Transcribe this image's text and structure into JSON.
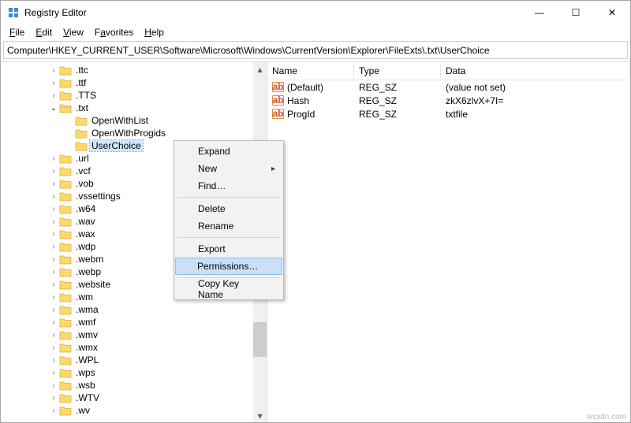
{
  "window": {
    "title": "Registry Editor",
    "buttons": {
      "min": "—",
      "max": "☐",
      "close": "✕"
    }
  },
  "menubar": {
    "file": "File",
    "edit": "Edit",
    "view": "View",
    "favorites": "Favorites",
    "help": "Help"
  },
  "path": "Computer\\HKEY_CURRENT_USER\\Software\\Microsoft\\Windows\\CurrentVersion\\Explorer\\FileExts\\.txt\\UserChoice",
  "tree": {
    "pre_items": [
      {
        "depth": 4,
        "chev": ">",
        "label": ".ttc"
      },
      {
        "depth": 4,
        "chev": ">",
        "label": ".ttf"
      },
      {
        "depth": 4,
        "chev": ">",
        "label": ".TTS"
      }
    ],
    "txt": {
      "depth": 4,
      "icon": "open",
      "label": ".txt"
    },
    "txt_children": [
      {
        "depth": 5,
        "label": "OpenWithList"
      },
      {
        "depth": 5,
        "label": "OpenWithProgids"
      },
      {
        "depth": 5,
        "label": "UserChoice",
        "selected": true
      }
    ],
    "post_items": [
      ".url",
      ".vcf",
      ".vob",
      ".vssettings",
      ".w64",
      ".wav",
      ".wax",
      ".wdp",
      ".webm",
      ".webp",
      ".website",
      ".wm",
      ".wma",
      ".wmf",
      ".wmv",
      ".wmx",
      ".WPL",
      ".wps",
      ".wsb",
      ".WTV",
      ".wv"
    ]
  },
  "list": {
    "columns": {
      "name": "Name",
      "type": "Type",
      "data": "Data"
    },
    "rows": [
      {
        "name": "(Default)",
        "type": "REG_SZ",
        "data": "(value not set)"
      },
      {
        "name": "Hash",
        "type": "REG_SZ",
        "data": "zkX6zlvX+7I="
      },
      {
        "name": "ProgId",
        "type": "REG_SZ",
        "data": "txtfile"
      }
    ]
  },
  "context_menu": {
    "items": [
      {
        "key": "expand",
        "label": "Expand"
      },
      {
        "key": "new",
        "label": "New",
        "submenu": true
      },
      {
        "key": "find",
        "label": "Find…"
      },
      {
        "sep": true
      },
      {
        "key": "delete",
        "label": "Delete"
      },
      {
        "key": "rename",
        "label": "Rename"
      },
      {
        "sep": true
      },
      {
        "key": "export",
        "label": "Export"
      },
      {
        "key": "permissions",
        "label": "Permissions…",
        "hover": true
      },
      {
        "sep": true
      },
      {
        "key": "copy-key-name",
        "label": "Copy Key Name"
      }
    ]
  },
  "watermark": "wsxdn.com",
  "icons": {
    "app_color": "#3a8ad6",
    "folder_fill": "#ffd96b",
    "folder_stroke": "#d7a93c",
    "reg_ab_bg": "#fff",
    "reg_ab_border": "#d28f3b",
    "reg_ab_text": "#d24b2f"
  }
}
